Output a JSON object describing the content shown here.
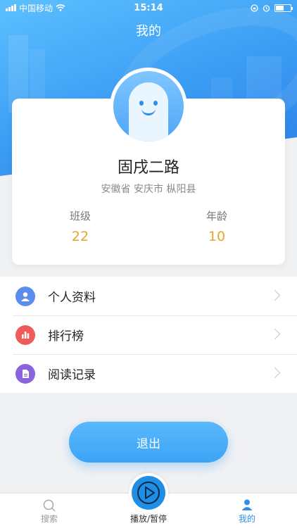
{
  "status_bar": {
    "carrier": "中国移动",
    "time": "15:14"
  },
  "header": {
    "title": "我的"
  },
  "profile": {
    "name": "固戌二路",
    "location": "安徽省 安庆市 枞阳县",
    "stats": [
      {
        "label": "班级",
        "value": "22"
      },
      {
        "label": "年龄",
        "value": "10"
      }
    ]
  },
  "menu": {
    "items": [
      {
        "label": "个人资料",
        "icon": "person-icon",
        "color": "#5b8def"
      },
      {
        "label": "排行榜",
        "icon": "bar-chart-icon",
        "color": "#ef5a5a"
      },
      {
        "label": "阅读记录",
        "icon": "document-icon",
        "color": "#8a63df"
      }
    ]
  },
  "logout": {
    "label": "退出"
  },
  "tabbar": {
    "search_label": "搜索",
    "play_label": "播放/暂停",
    "mine_label": "我的"
  },
  "colors": {
    "accent": "#2f8fe8",
    "stat_value": "#e7a62b"
  }
}
